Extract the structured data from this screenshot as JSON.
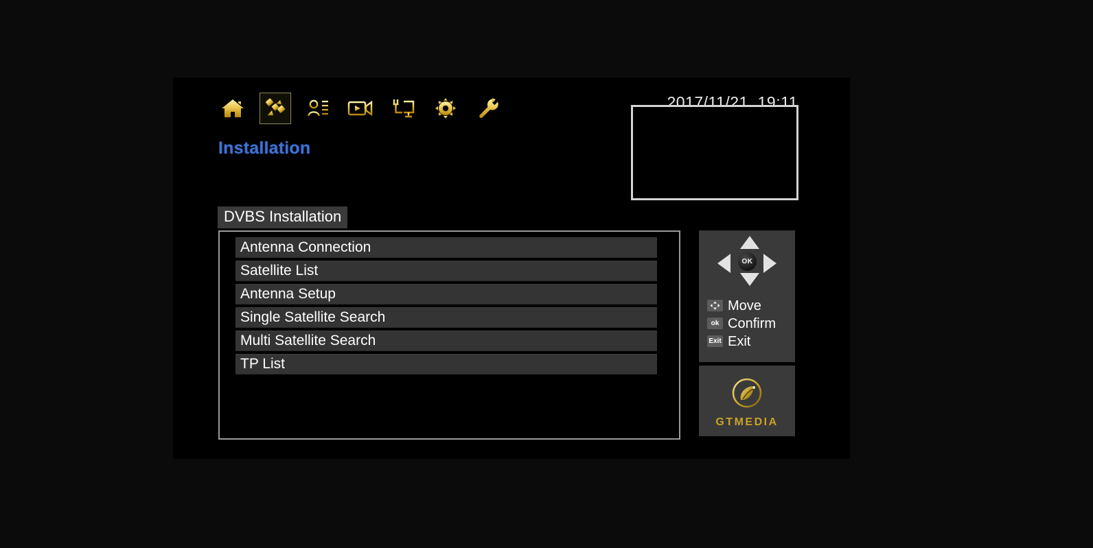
{
  "header": {
    "clock": "2017/11/21  19:11",
    "page_title": "Installation",
    "icons": [
      {
        "name": "home-icon",
        "label": "Home",
        "selected": false
      },
      {
        "name": "satellite-icon",
        "label": "Installation",
        "selected": true
      },
      {
        "name": "channel-list-icon",
        "label": "Channel",
        "selected": false
      },
      {
        "name": "media-icon",
        "label": "Media",
        "selected": false
      },
      {
        "name": "connection-icon",
        "label": "Connection",
        "selected": false
      },
      {
        "name": "settings-gear-icon",
        "label": "Settings",
        "selected": false
      },
      {
        "name": "tools-wrench-icon",
        "label": "Tools",
        "selected": false
      }
    ]
  },
  "preview": {
    "name": "video-preview-box",
    "content": ""
  },
  "main": {
    "section_tab": "DVBS Installation",
    "menu_items": [
      {
        "label": "Antenna Connection"
      },
      {
        "label": "Satellite List"
      },
      {
        "label": "Antenna Setup"
      },
      {
        "label": "Single Satellite Search"
      },
      {
        "label": "Multi Satellite Search"
      },
      {
        "label": "TP List"
      }
    ]
  },
  "nav_help": {
    "ok_label": "OK",
    "hints": [
      {
        "key": "dpad",
        "key_label": "",
        "label": "Move"
      },
      {
        "key": "ok",
        "key_label": "ok",
        "label": "Confirm"
      },
      {
        "key": "exit",
        "key_label": "Exit",
        "label": "Exit"
      }
    ]
  },
  "brand": {
    "name": "GTMEDIA",
    "mark": "satellite-dish-logo"
  },
  "colors": {
    "screen_background": "#000000",
    "page_background": "#0b0b0b",
    "accent_gold": "#e8c44a",
    "title_blue": "#3f73d6",
    "row_background": "#343434",
    "panel_gray": "#3a3a3a",
    "brand_gold": "#c9a227",
    "text_white": "#ffffff"
  }
}
